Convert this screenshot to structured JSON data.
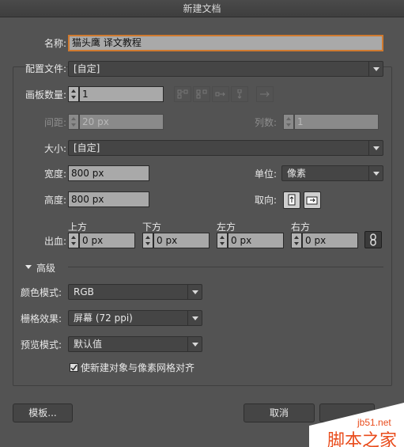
{
  "window": {
    "title": "新建文档"
  },
  "name": {
    "label": "名称:",
    "value": "猫头鹰 译文教程"
  },
  "profile": {
    "label": "配置文件:",
    "value": "[自定]"
  },
  "artboards": {
    "count_label": "画板数量:",
    "count_value": "1"
  },
  "spacing": {
    "label": "间距:",
    "value": "20 px"
  },
  "columns": {
    "label": "列数:",
    "value": "1"
  },
  "size": {
    "label": "大小:",
    "value": "[自定]"
  },
  "width": {
    "label": "宽度:",
    "value": "800 px"
  },
  "height": {
    "label": "高度:",
    "value": "800 px"
  },
  "units": {
    "label": "单位:",
    "value": "像素"
  },
  "orientation": {
    "label": "取向:"
  },
  "bleed": {
    "label": "出血:",
    "top": {
      "label": "上方",
      "value": "0 px"
    },
    "bottom": {
      "label": "下方",
      "value": "0 px"
    },
    "left": {
      "label": "左方",
      "value": "0 px"
    },
    "right": {
      "label": "右方",
      "value": "0 px"
    }
  },
  "advanced": {
    "title": "高级",
    "color_mode": {
      "label": "颜色模式:",
      "value": "RGB"
    },
    "raster": {
      "label": "栅格效果:",
      "value": "屏幕 (72 ppi)"
    },
    "preview": {
      "label": "预览模式:",
      "value": "默认值"
    },
    "align_pixel": {
      "label": "使新建对象与像素网格对齐",
      "checked": true
    }
  },
  "buttons": {
    "templates": "模板...",
    "cancel": "取消"
  },
  "watermark": {
    "url": "jb51.net",
    "brand": "脚本之家"
  },
  "colors": {
    "background": "#535353",
    "focus": "#d07a2f",
    "watermark": "#e94c1c"
  }
}
